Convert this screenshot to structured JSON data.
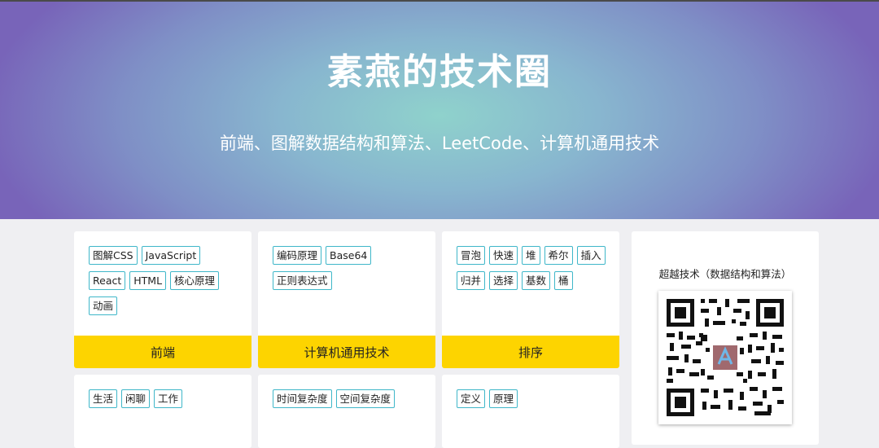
{
  "hero": {
    "title": "素燕的技术圈",
    "subtitle": "前端、图解数据结构和算法、LeetCode、计算机通用技术"
  },
  "cards": [
    {
      "tags": [
        "图解CSS",
        "JavaScript",
        "React",
        "HTML",
        "核心原理",
        "动画"
      ],
      "footer": "前端"
    },
    {
      "tags": [
        "编码原理",
        "Base64",
        "正则表达式"
      ],
      "footer": "计算机通用技术"
    },
    {
      "tags": [
        "冒泡",
        "快速",
        "堆",
        "希尔",
        "插入",
        "归并",
        "选择",
        "基数",
        "桶"
      ],
      "footer": "排序"
    },
    {
      "tags": [
        "生活",
        "闲聊",
        "工作"
      ],
      "footer": ""
    },
    {
      "tags": [
        "时间复杂度",
        "空间复杂度"
      ],
      "footer": ""
    },
    {
      "tags": [
        "定义",
        "原理"
      ],
      "footer": ""
    }
  ],
  "qr": {
    "caption": "超越技术（数据结构和算法）",
    "icon": "qr-code-icon"
  },
  "colors": {
    "accent": "#fdd400",
    "tag_border": "#3fb7c9",
    "hero_center": "#8fd2cc",
    "hero_edge": "#7864b9"
  }
}
